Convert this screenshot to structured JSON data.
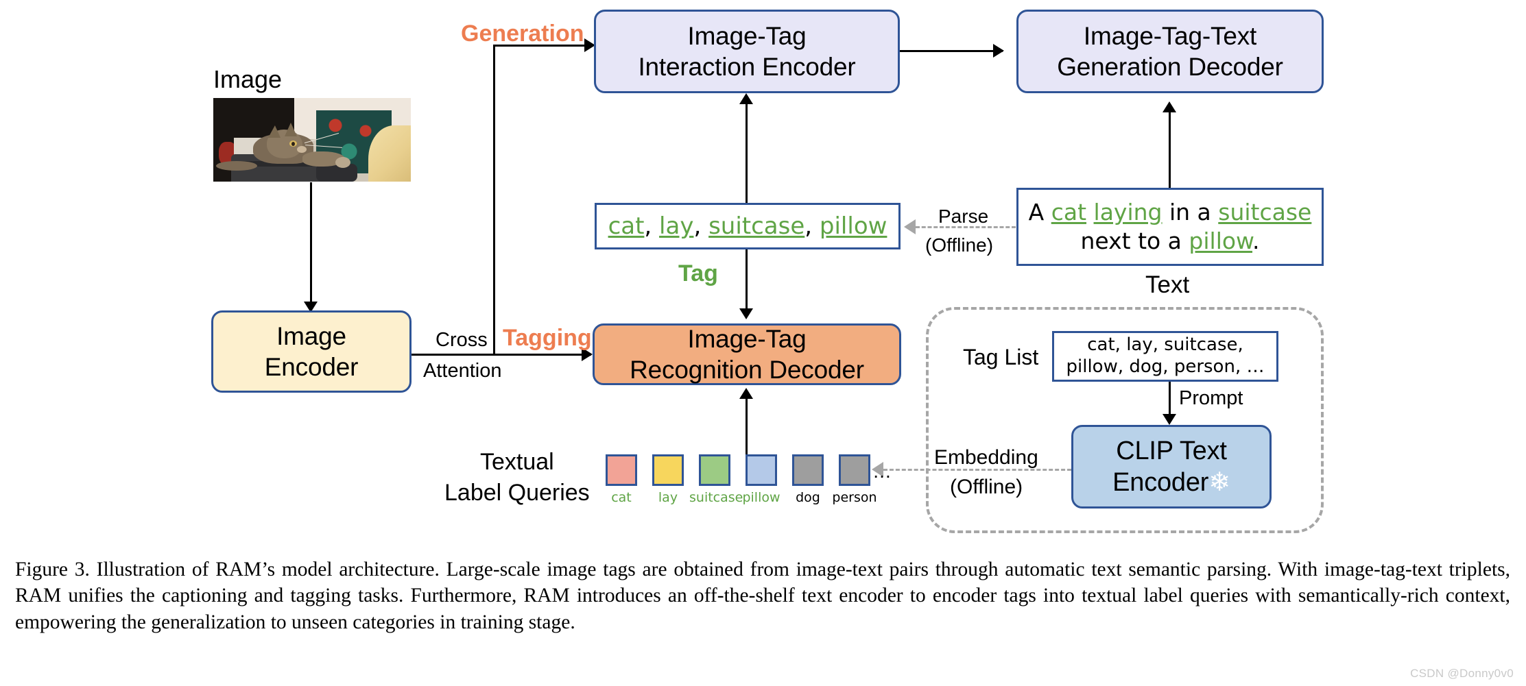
{
  "figure": {
    "input": {
      "image_label": "Image",
      "photo_alt": "kitten laying on a suitcase next to a patterned pillow"
    },
    "boxes": {
      "image_encoder": {
        "line1": "Image",
        "line2": "Encoder",
        "fill": "#fdf0ce",
        "border": "#2f5496"
      },
      "interaction_encoder": {
        "line1": "Image-Tag",
        "line2": "Interaction Encoder",
        "fill": "#e7e6f7",
        "border": "#2f5496"
      },
      "generation_decoder": {
        "line1": "Image-Tag-Text",
        "line2": "Generation Decoder",
        "fill": "#e7e6f7",
        "border": "#2f5496"
      },
      "recognition_decoder": {
        "line1": "Image-Tag",
        "line2": "Recognition Decoder",
        "fill": "#f2ad80",
        "border": "#2f5496"
      },
      "clip_text_encoder": {
        "line1": "CLIP Text",
        "line2": "Encoder",
        "snowflake": "❄",
        "fill": "#b9d2e9",
        "border": "#2f5496"
      }
    },
    "tag_box": {
      "caption_below": "Tag",
      "tokens": [
        {
          "text": "cat",
          "tag": true
        },
        {
          "text": ", ",
          "tag": false
        },
        {
          "text": "lay",
          "tag": true
        },
        {
          "text": ", ",
          "tag": false
        },
        {
          "text": "suitcase",
          "tag": true
        },
        {
          "text": ", ",
          "tag": false
        },
        {
          "text": "pillow",
          "tag": true
        }
      ]
    },
    "text_box": {
      "caption_below": "Text",
      "line1": [
        {
          "text": "A ",
          "tag": false
        },
        {
          "text": "cat",
          "tag": true
        },
        {
          "text": " ",
          "tag": false
        },
        {
          "text": "laying",
          "tag": true
        },
        {
          "text": " in a ",
          "tag": false
        },
        {
          "text": "suitcase",
          "tag": true
        }
      ],
      "line2": [
        {
          "text": "next to a ",
          "tag": false
        },
        {
          "text": "pillow",
          "tag": true
        },
        {
          "text": ".",
          "tag": false
        }
      ]
    },
    "tag_list": {
      "label": "Tag List",
      "line1": "cat, lay, suitcase,",
      "line2": "pillow, dog, person, …"
    },
    "textual_label_queries": {
      "label_line1": "Textual",
      "label_line2": "Label Queries",
      "ellipsis": "…",
      "queries": [
        {
          "name": "cat",
          "color": "#f2a396",
          "name_color": "#5fa445"
        },
        {
          "name": "lay",
          "color": "#f7d65d",
          "name_color": "#5fa445"
        },
        {
          "name": "suitcase",
          "color": "#9ccb84",
          "name_color": "#5fa445"
        },
        {
          "name": "pillow",
          "color": "#b4c9e8",
          "name_color": "#5fa445"
        },
        {
          "name": "dog",
          "color": "#9e9e9e",
          "name_color": "#000000"
        },
        {
          "name": "person",
          "color": "#9e9e9e",
          "name_color": "#000000"
        }
      ]
    },
    "edge_labels": {
      "generation": "Generation",
      "tagging": "Tagging",
      "cross": "Cross",
      "attention": "Attention",
      "parse_line1": "Parse",
      "parse_line2": "(Offline)",
      "prompt": "Prompt",
      "embedding_line1": "Embedding",
      "embedding_line2": "(Offline)"
    },
    "accent_color": "#ed7d50",
    "tag_green": "#5fa445"
  },
  "caption": {
    "text": "Figure 3. Illustration of RAM’s model architecture.  Large-scale image tags are obtained from image-text pairs through automatic text semantic parsing.  With image-tag-text triplets, RAM unifies the captioning and tagging tasks.  Furthermore, RAM introduces an off-the-shelf text encoder to encoder tags into textual label queries with semantically-rich context, empowering the generalization to unseen categories in training stage."
  },
  "watermark": {
    "text": "CSDN @Donny0v0"
  }
}
